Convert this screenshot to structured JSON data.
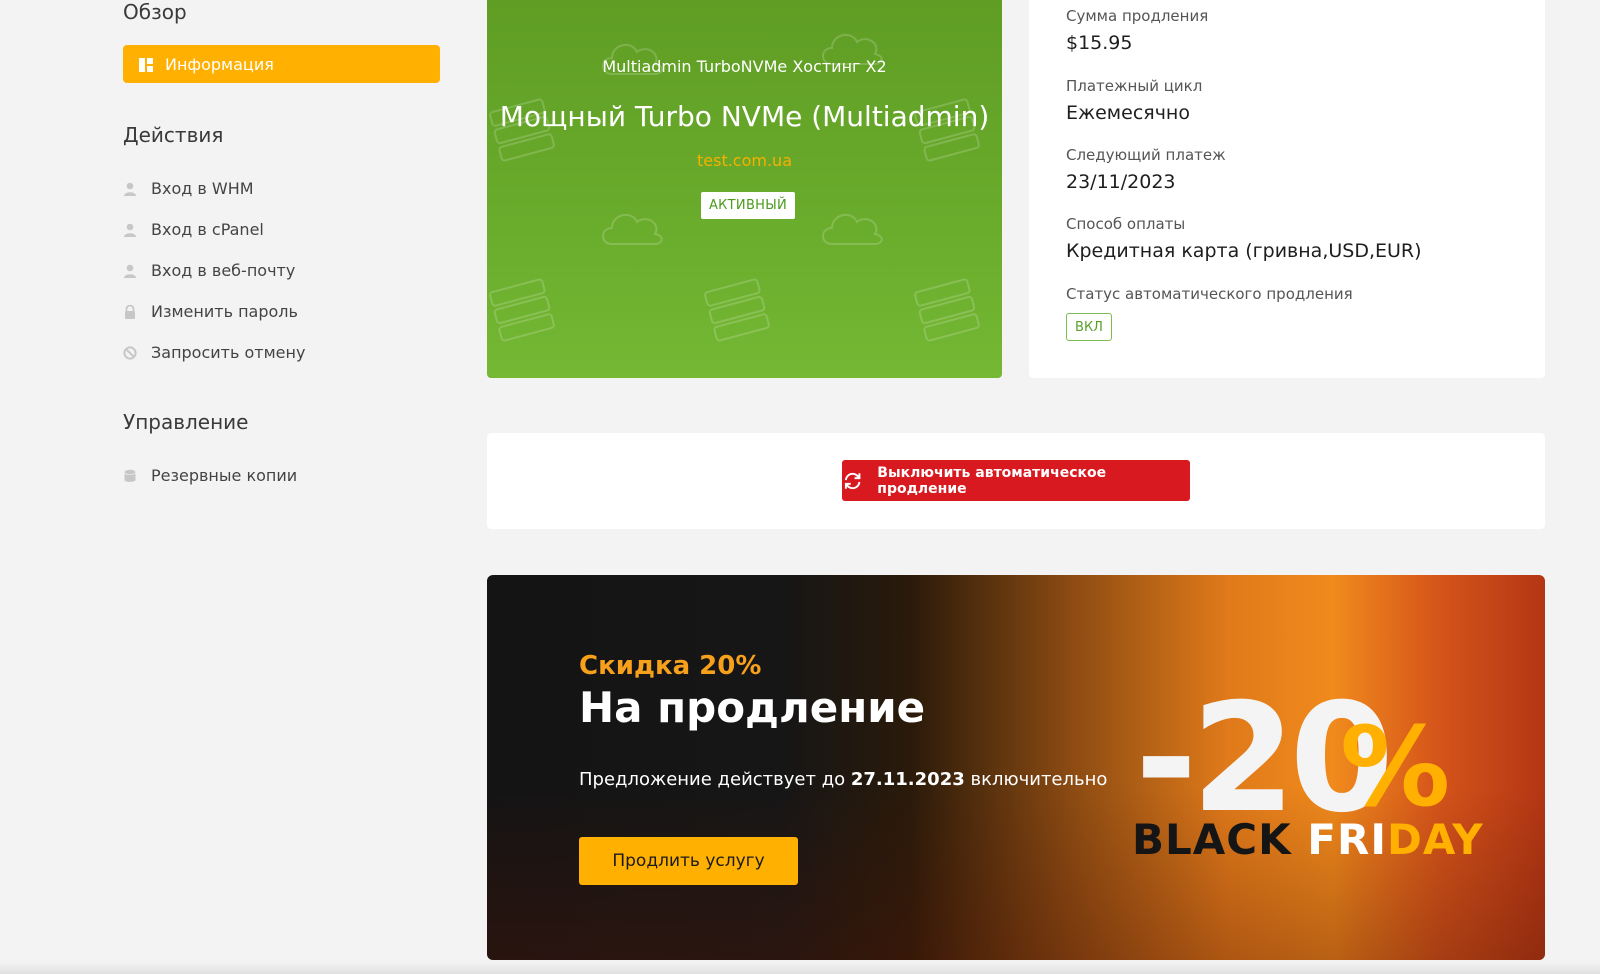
{
  "sidebar": {
    "overview_heading": "Обзор",
    "active_item": {
      "label": "Информация",
      "icon": "dashboard-icon"
    },
    "actions_heading": "Действия",
    "actions": [
      {
        "label": "Вход в WHM",
        "icon": "user-icon"
      },
      {
        "label": "Вход в cPanel",
        "icon": "user-icon"
      },
      {
        "label": "Вход в веб-почту",
        "icon": "user-icon"
      },
      {
        "label": "Изменить пароль",
        "icon": "lock-icon"
      },
      {
        "label": "Запросить отмену",
        "icon": "ban-icon"
      }
    ],
    "management_heading": "Управление",
    "management": [
      {
        "label": "Резервные копии",
        "icon": "database-icon"
      }
    ]
  },
  "product": {
    "subtitle": "Multiadmin TurboNVMe Хостинг X2",
    "title": "Мощный Turbo NVMe (Multiadmin)",
    "domain": "test.com.ua",
    "status": "АКТИВНЫЙ",
    "background_color": "#6aa92c"
  },
  "details": {
    "renewal_amount_label": "Сумма продления",
    "renewal_amount": "$15.95",
    "billing_cycle_label": "Платежный цикл",
    "billing_cycle": "Ежемесячно",
    "next_payment_label": "Следующий платеж",
    "next_payment": "23/11/2023",
    "payment_method_label": "Способ оплаты",
    "payment_method": "Кредитная карта (гривна,USD,EUR)",
    "auto_renew_label": "Статус автоматического продления",
    "auto_renew_status": "ВКЛ"
  },
  "actions": {
    "disable_auto_renew_label": "Выключить автоматическое продление",
    "disable_auto_renew_icon": "sync-icon",
    "danger_color": "#d81a20"
  },
  "promo": {
    "discount": "Скидка 20%",
    "headline": "На продление",
    "offer_prefix": "Предложение действует до ",
    "offer_date": "27.11.2023",
    "offer_suffix": " включительно",
    "cta_label": "Продлить услугу",
    "badge_number": "-20",
    "badge_percent": "%",
    "badge_black": "BLACK ",
    "badge_fri": "FRI",
    "badge_day": "DAY",
    "accent_color": "#ffb000"
  }
}
